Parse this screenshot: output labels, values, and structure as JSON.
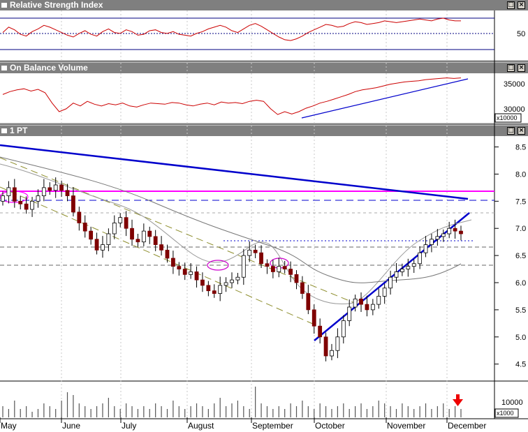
{
  "panes": {
    "rsi": {
      "title": "Relative Strength Index",
      "level_label": "50"
    },
    "obv": {
      "title": "On Balance Volume",
      "tick_35000": "35000",
      "tick_30000": "30000",
      "scale": "x10000"
    },
    "price": {
      "title": "1 PT",
      "y_ticks": [
        "8.5",
        "8.0",
        "7.5",
        "7.0",
        "6.5",
        "6.0",
        "5.5",
        "5.0",
        "4.5"
      ]
    },
    "volume": {
      "tick_10000": "10000",
      "scale": "x1000"
    }
  },
  "months": [
    "May",
    "June",
    "July",
    "August",
    "September",
    "October",
    "November",
    "December"
  ],
  "buttons": {
    "restore": "□",
    "close": "×"
  },
  "colors": {
    "rsi_line": "#cc0000",
    "obv_line": "#cc0000",
    "trendline": "#0000cc",
    "resistance": "#ff00ff",
    "channel": "#8f8f2f",
    "candle_down": "#7f0000",
    "candle_up": "#ffffff"
  },
  "chart_data": {
    "type": "candlestick",
    "title": "1 PT",
    "ylim": [
      4.2,
      8.7
    ],
    "x_categories": [
      "May",
      "June",
      "July",
      "August",
      "September",
      "October",
      "November",
      "December"
    ],
    "reference_levels": {
      "resistance_magenta": 7.45,
      "dashed_blue": 7.3,
      "dotted_blue": 6.42,
      "gray_dashed_1": 6.28,
      "gray_dashed_2": 5.93
    },
    "price_series": [
      7.6,
      7.75,
      7.5,
      7.45,
      7.35,
      7.5,
      7.6,
      7.75,
      7.7,
      7.8,
      7.7,
      7.6,
      7.3,
      7.1,
      6.95,
      6.8,
      6.6,
      6.7,
      6.9,
      7.1,
      7.2,
      7.0,
      6.8,
      6.75,
      6.95,
      6.85,
      6.7,
      6.6,
      6.45,
      6.3,
      6.25,
      6.15,
      6.2,
      6.05,
      5.95,
      5.85,
      5.8,
      5.95,
      6.0,
      6.05,
      6.1,
      6.5,
      6.6,
      6.55,
      6.35,
      6.3,
      6.2,
      6.3,
      6.25,
      6.15,
      6.0,
      5.8,
      5.5,
      5.2,
      5.0,
      4.65,
      4.75,
      5.0,
      5.3,
      5.55,
      5.7,
      5.6,
      5.5,
      5.6,
      5.75,
      5.9,
      6.1,
      6.2,
      6.25,
      6.3,
      6.35,
      6.55,
      6.7,
      6.8,
      6.85,
      6.9,
      7.0,
      6.95,
      6.9
    ],
    "volume_series": [
      4,
      3,
      6,
      3,
      4,
      2,
      3,
      5,
      4,
      3,
      6,
      9,
      8,
      5,
      4,
      3,
      4,
      5,
      7,
      4,
      3,
      5,
      4,
      3,
      4,
      3,
      5,
      4,
      3,
      6,
      4,
      3,
      4,
      5,
      4,
      3,
      5,
      7,
      4,
      5,
      6,
      4,
      3,
      11,
      5,
      4,
      3,
      4,
      3,
      5,
      4,
      6,
      4,
      3,
      5,
      4,
      3,
      4,
      5,
      3,
      4,
      5,
      3,
      4,
      6,
      5,
      4,
      3,
      5,
      4,
      3,
      4,
      5,
      3,
      4,
      5,
      3,
      4,
      3
    ],
    "rsi_series": [
      49,
      55,
      52,
      47,
      45,
      50,
      53,
      57,
      55,
      52,
      49,
      46,
      44,
      48,
      51,
      47,
      45,
      50,
      53,
      49,
      48,
      52,
      50,
      46,
      47,
      51,
      52,
      49,
      48,
      50,
      47,
      46,
      45,
      48,
      50,
      53,
      55,
      57,
      55,
      51,
      49,
      53,
      57,
      59,
      56,
      52,
      48,
      44,
      41,
      40,
      42,
      45,
      49,
      52,
      55,
      58,
      57,
      55,
      56,
      59,
      61,
      60,
      58,
      59,
      60,
      62,
      61,
      60,
      61,
      62,
      63,
      64,
      63,
      62,
      64,
      65,
      63,
      62,
      62
    ],
    "obv_series": [
      33000,
      33500,
      33800,
      34000,
      33600,
      33900,
      33300,
      31500,
      30000,
      30500,
      31500,
      31000,
      31800,
      31300,
      31000,
      31400,
      31200,
      31500,
      31000,
      30800,
      31200,
      31500,
      31400,
      31300,
      31600,
      31500,
      31200,
      31000,
      31300,
      31500,
      31200,
      31700,
      31500,
      31600,
      31400,
      31800,
      32000,
      31800,
      30500,
      29500,
      30000,
      29600,
      30000,
      30600,
      31000,
      31500,
      31800,
      32200,
      32600,
      33000,
      33500,
      33800,
      34000,
      34200,
      34500,
      34800,
      35000,
      35200,
      35300,
      35400,
      35600,
      35700,
      35800,
      35900,
      35800,
      35900
    ],
    "annotations": [
      "falling trendline from upper left to resistance",
      "rising support trendline from October low",
      "parallel downward channel (dashed)"
    ],
    "arrow": "red down arrow over December volume"
  }
}
